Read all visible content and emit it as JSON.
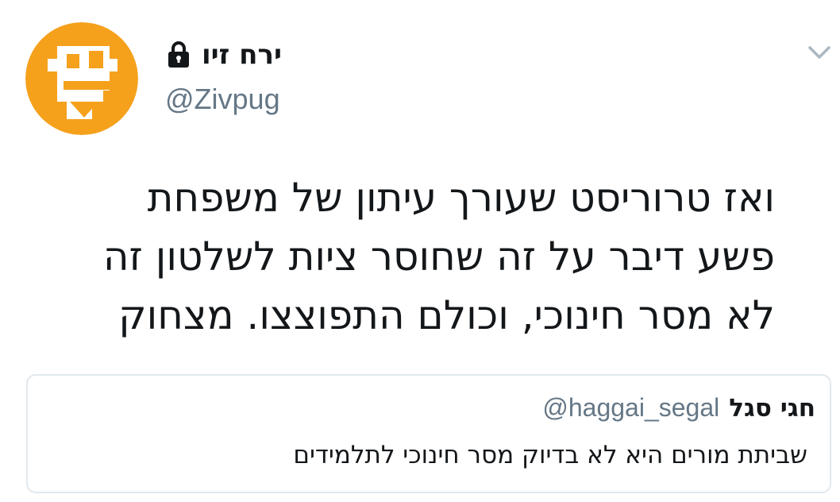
{
  "tweet": {
    "author": {
      "display_name": "ירח זיו",
      "handle": "@Zivpug",
      "protected_icon": "lock-icon",
      "avatar": {
        "icon": "robot-face-avatar",
        "background_color": "#f5a11c",
        "face_color": "#ffffff"
      }
    },
    "menu_icon": "chevron-down-icon",
    "text_lines": [
      "ואז טרוריסט שעורך עיתון של משפחת",
      "פשע דיבר על זה שחוסר ציות לשלטון זה",
      "לא מסר חינוכי, וכולם התפוצצו. מצחוק"
    ],
    "quoted_tweet": {
      "display_name": "חגי סגל",
      "handle": "@haggai_segal",
      "text": "שביתת מורים היא לא בדיוק מסר חינוכי לתלמידים"
    }
  },
  "colors": {
    "text": "#14171a",
    "secondary_text": "#657786",
    "border": "#e1e8ed",
    "icon_gray": "#aab8c2"
  }
}
